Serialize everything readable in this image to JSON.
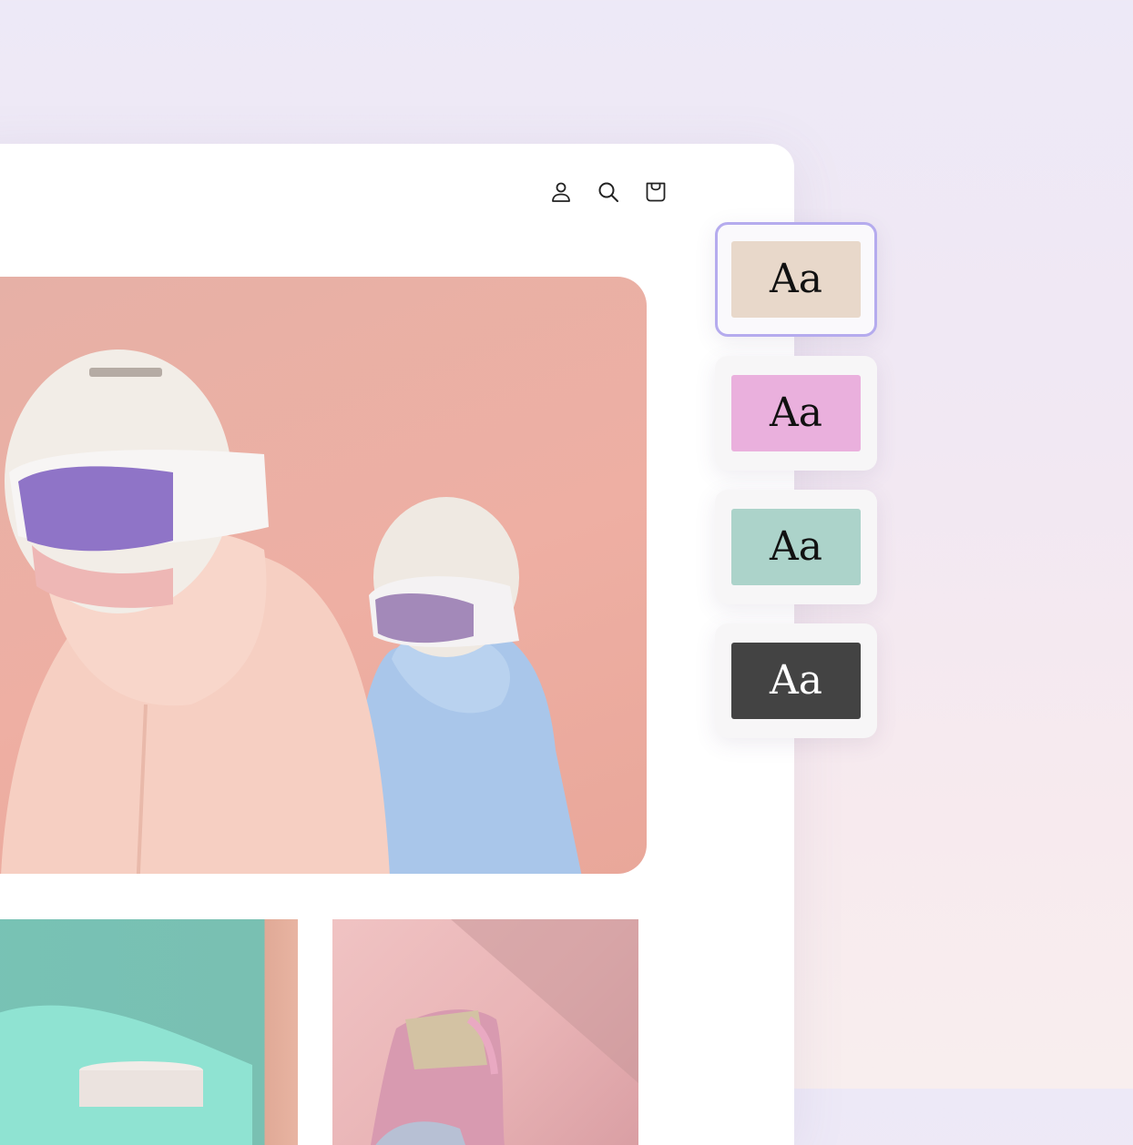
{
  "header": {
    "icons": [
      "user-icon",
      "search-icon",
      "cart-icon"
    ]
  },
  "swatches": [
    {
      "label": "Aa",
      "bg": "#e8d8ca",
      "fg": "#111111",
      "selected": true
    },
    {
      "label": "Aa",
      "bg": "#eab0dd",
      "fg": "#111111",
      "selected": false
    },
    {
      "label": "Aa",
      "bg": "#acd3ca",
      "fg": "#111111",
      "selected": false
    },
    {
      "label": "Aa",
      "bg": "#434343",
      "fg": "#ffffff",
      "selected": false
    }
  ],
  "colors": {
    "selection_border": "#b5abee",
    "hero": "#eeafa3",
    "tile_teal": "#78c2b5",
    "tile_pink": "#f0c3c3"
  }
}
